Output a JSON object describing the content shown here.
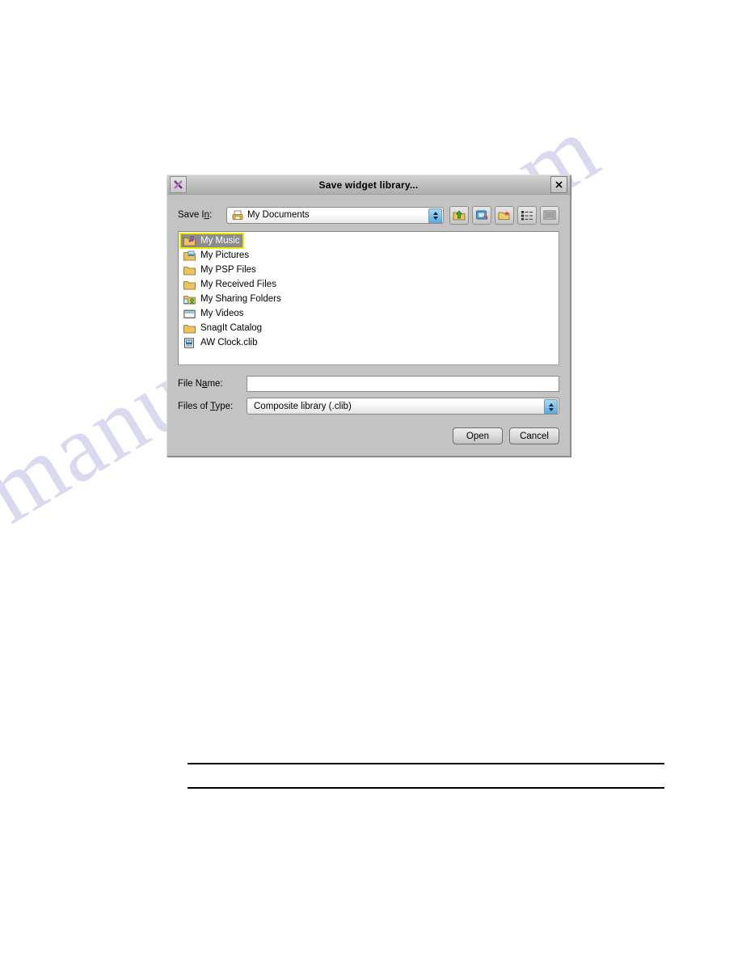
{
  "page": {
    "watermark_text": "manualshive.com",
    "watermark_color": "#d9d9f0",
    "rules": 2
  },
  "dialog": {
    "title": "Save widget library...",
    "app_icon": "app-x-icon",
    "close_icon": "close-icon",
    "savein": {
      "label_pre": "Save I",
      "label_mnemonic": "n",
      "label_post": ":",
      "value": "My Documents",
      "icon": "my-documents-icon",
      "spinner": "updown-spinner-icon"
    },
    "toolbar": [
      {
        "name": "up-one-level-button",
        "icon": "folder-up-arrow-icon",
        "title": "Up One Level"
      },
      {
        "name": "home-button",
        "icon": "home-desktop-icon",
        "title": "Home"
      },
      {
        "name": "new-folder-button",
        "icon": "new-folder-icon",
        "title": "Create New Folder"
      },
      {
        "name": "list-view-button",
        "icon": "list-view-icon",
        "title": "List"
      },
      {
        "name": "details-view-button",
        "icon": "details-view-icon",
        "title": "Details"
      }
    ],
    "files": [
      {
        "label": "My Music",
        "icon": "folder-music-icon",
        "selected": true
      },
      {
        "label": "My Pictures",
        "icon": "folder-pictures-icon",
        "selected": false
      },
      {
        "label": "My PSP Files",
        "icon": "folder-icon",
        "selected": false
      },
      {
        "label": "My Received Files",
        "icon": "folder-icon",
        "selected": false
      },
      {
        "label": "My Sharing Folders",
        "icon": "folder-shared-icon",
        "selected": false
      },
      {
        "label": "My Videos",
        "icon": "folder-videos-icon",
        "selected": false
      },
      {
        "label": "SnagIt Catalog",
        "icon": "folder-icon",
        "selected": false
      },
      {
        "label": "AW Clock.clib",
        "icon": "clib-file-icon",
        "selected": false
      }
    ],
    "filename": {
      "label_pre": "File N",
      "label_mnemonic": "a",
      "label_post": "me:",
      "value": "",
      "placeholder": ""
    },
    "filetype": {
      "label_pre": "Files of ",
      "label_mnemonic": "T",
      "label_post": "ype:",
      "value": "Composite library (.clib)",
      "options": [
        "Composite library (.clib)"
      ],
      "spinner": "updown-spinner-icon"
    },
    "buttons": {
      "open": "Open",
      "cancel": "Cancel"
    },
    "colors": {
      "face": "#c3c3c3",
      "selection_bg": "#8c8c8c",
      "selection_border": "#f2f200",
      "spinner_blue": "#5aa8d8"
    }
  }
}
